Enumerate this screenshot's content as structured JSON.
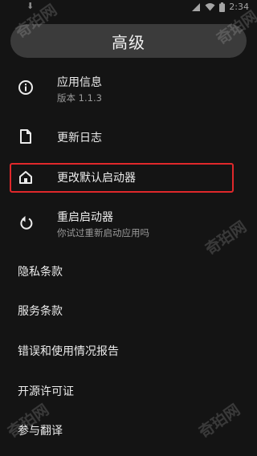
{
  "status": {
    "time": "2:34",
    "left_icon": "download-icon"
  },
  "header": {
    "title": "高级"
  },
  "items": [
    {
      "icon": "info-icon",
      "label": "应用信息",
      "sub": "版本 1.1.3"
    },
    {
      "icon": "file-icon",
      "label": "更新日志"
    },
    {
      "icon": "home-icon",
      "label": "更改默认启动器"
    },
    {
      "icon": "restart-icon",
      "label": "重启启动器",
      "sub": "你试过重新启动应用吗"
    }
  ],
  "links": [
    {
      "label": "隐私条款"
    },
    {
      "label": "服务条款"
    },
    {
      "label": "错误和使用情况报告"
    },
    {
      "label": "开源许可证"
    },
    {
      "label": "参与翻译"
    }
  ],
  "watermark": {
    "text": "奇珀网"
  },
  "colors": {
    "background": "#141414",
    "title_bar": "#3b3b3b",
    "highlight": "#e0282b",
    "text": "#ececec",
    "subtext": "#9a9a9a"
  }
}
